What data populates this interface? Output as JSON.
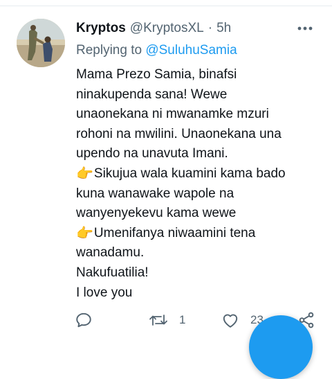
{
  "tweet": {
    "author_name": "Kryptos",
    "author_handle": "@KryptosXL",
    "separator": "·",
    "timestamp": "5h",
    "replying_prefix": "Replying to",
    "replying_to": "@SuluhuSamia",
    "lines": [
      "Mama Prezo Samia, binafsi",
      "ninakupenda sana! Wewe",
      "unaonekana ni mwanamke mzuri",
      "rohoni na mwilini. Unaonekana una",
      "upendo na unavuta Imani.",
      "Sikujua wala kuamini kama bado",
      "kuna wanawake wapole na",
      "wanyenyekevu kama wewe",
      "Umenifanya niwaamini tena",
      "wanadamu.",
      "Nakufuatilia!",
      "I love you"
    ],
    "emoji": "👉"
  },
  "actions": {
    "reply_icon": "reply-icon",
    "retweet_icon": "retweet-icon",
    "retweet_count": "1",
    "like_icon": "like-icon",
    "like_count": "23",
    "share_icon": "share-icon"
  },
  "colors": {
    "accent": "#1d9bf0",
    "text_primary": "#0f1419",
    "text_secondary": "#536471",
    "divider": "#e6ecf0"
  }
}
